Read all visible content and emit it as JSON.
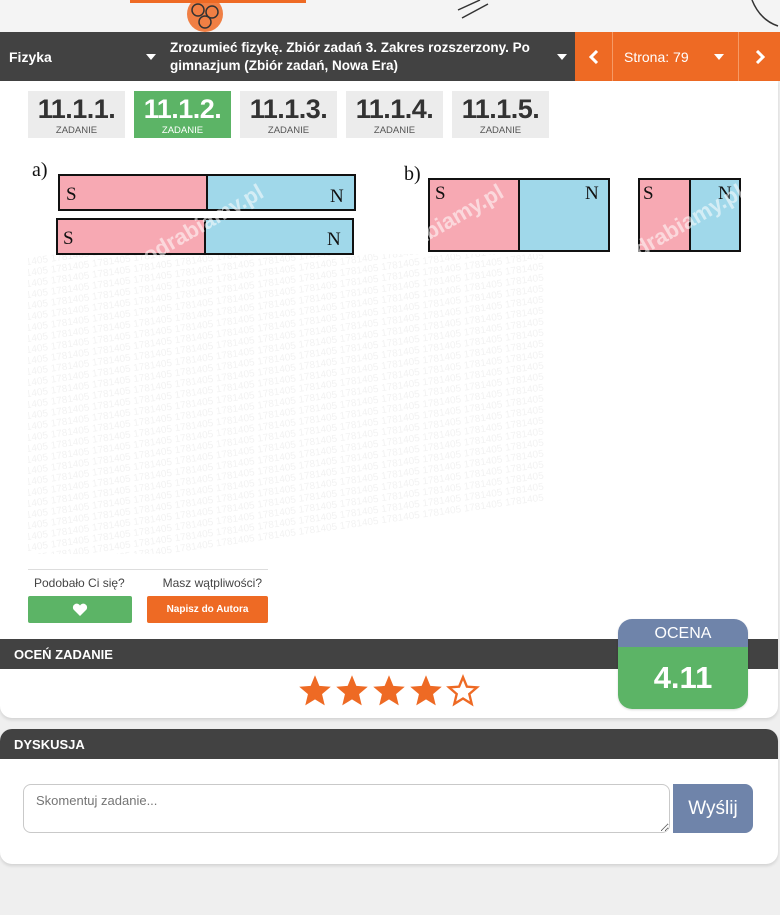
{
  "nav": {
    "subject": "Fizyka",
    "book": "Zrozumieć fizykę. Zbiór zadań 3. Zakres rozszerzony. Po gimnazjum (Zbiór zadań, Nowa Era)",
    "page": "Strona: 79"
  },
  "tasks": [
    {
      "num": "11.1.1.",
      "label": "ZADANIE"
    },
    {
      "num": "11.1.2.",
      "label": "ZADANIE"
    },
    {
      "num": "11.1.3.",
      "label": "ZADANIE"
    },
    {
      "num": "11.1.4.",
      "label": "ZADANIE"
    },
    {
      "num": "11.1.5.",
      "label": "ZADANIE"
    }
  ],
  "figure": {
    "label_a": "a)",
    "label_b": "b)",
    "pole_s": "S",
    "pole_n": "N",
    "watermark": "1781405",
    "brand_watermark": "odrabiamy.pl"
  },
  "feedback": {
    "liked_label": "Podobało Ci się?",
    "doubts_label": "Masz wątpliwości?",
    "ask_button": "Napisz do Autora"
  },
  "rating": {
    "section_title": "OCEŃ ZADANIE",
    "stars_filled": 4,
    "stars_total": 5,
    "score_title": "OCENA",
    "score": "4.11"
  },
  "discussion": {
    "section_title": "DYSKUSJA",
    "placeholder": "Skomentuj zadanie...",
    "send": "Wyślij"
  },
  "colors": {
    "orange": "#ee6a24",
    "green": "#5cb466",
    "dark": "#424242",
    "blue_grey": "#6f84aa",
    "magnet_s": "#f7a9b3",
    "magnet_n": "#a0d8ea"
  }
}
